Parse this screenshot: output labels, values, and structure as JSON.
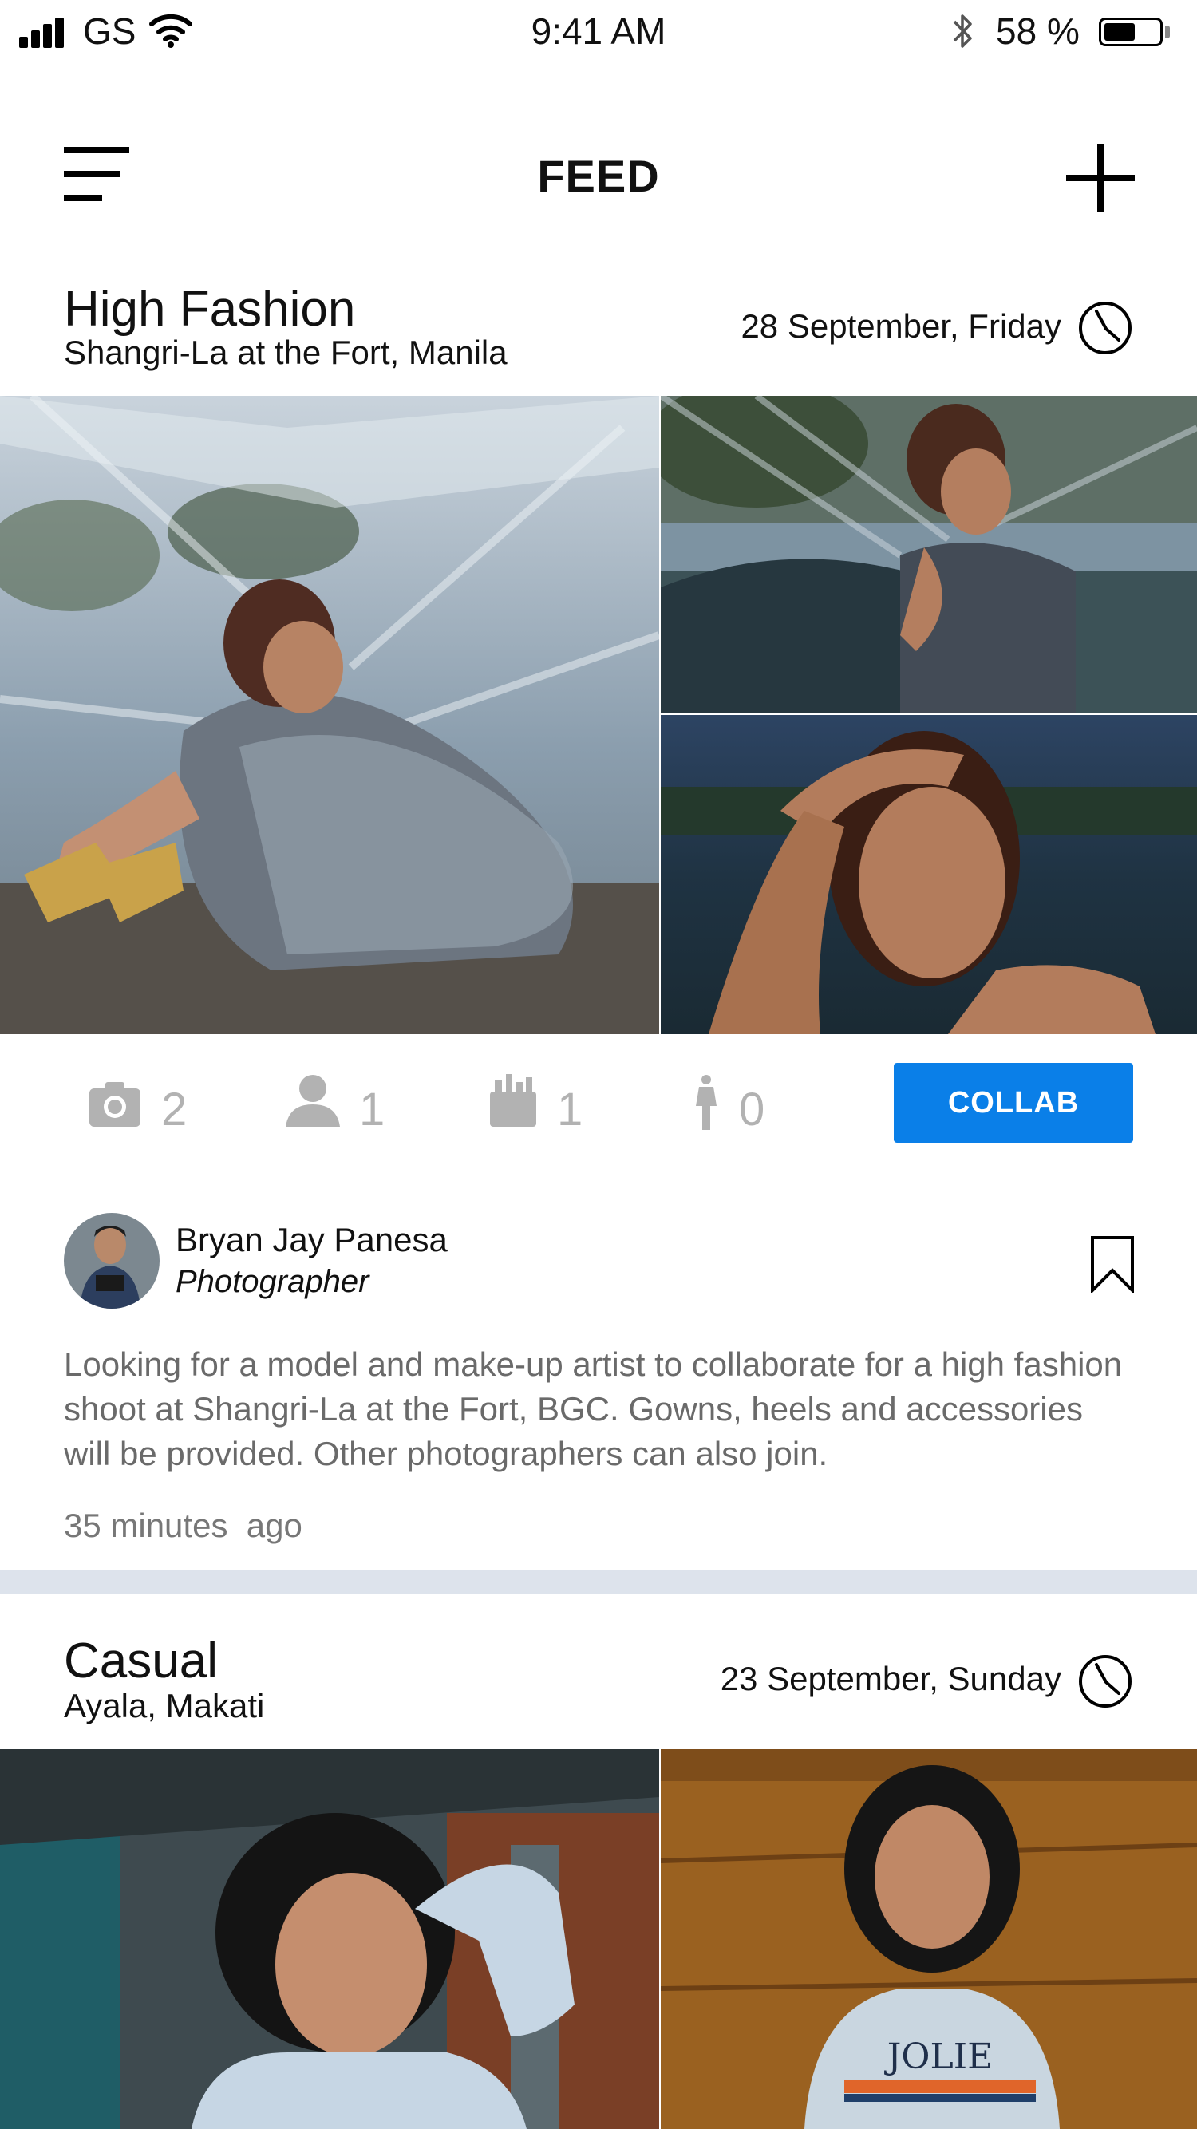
{
  "status_bar": {
    "carrier": "GS",
    "time": "9:41 AM",
    "battery_percent": "58 %",
    "battery_level": 0.58
  },
  "nav": {
    "title": "FEED",
    "menu_icon": "hamburger-menu-icon",
    "add_icon": "plus-icon"
  },
  "posts": [
    {
      "title": "High Fashion",
      "location": "Shangri-La at the Fort, Manila",
      "date": "28 September, Friday",
      "stats": {
        "photographers": "2",
        "models": "1",
        "makeup_artists": "1",
        "stylists": "0"
      },
      "collab_label": "COLLAB",
      "author": {
        "name": "Bryan Jay Panesa",
        "role": "Photographer"
      },
      "description": "Looking for a model and make-up artist to collaborate for a high fashion shoot at Shangri-La at the Fort, BGC. Gowns, heels and accessories will be provided. Other photographers can also join.",
      "time_ago": "35 minutes  ago"
    },
    {
      "title": "Casual",
      "location": "Ayala, Makati",
      "date": "23 September, Sunday",
      "shirt_text": "JOLIE"
    }
  ],
  "colors": {
    "accent": "#0a7fe8",
    "muted_icon": "#b2b2b2",
    "divider": "#dde3ec"
  }
}
